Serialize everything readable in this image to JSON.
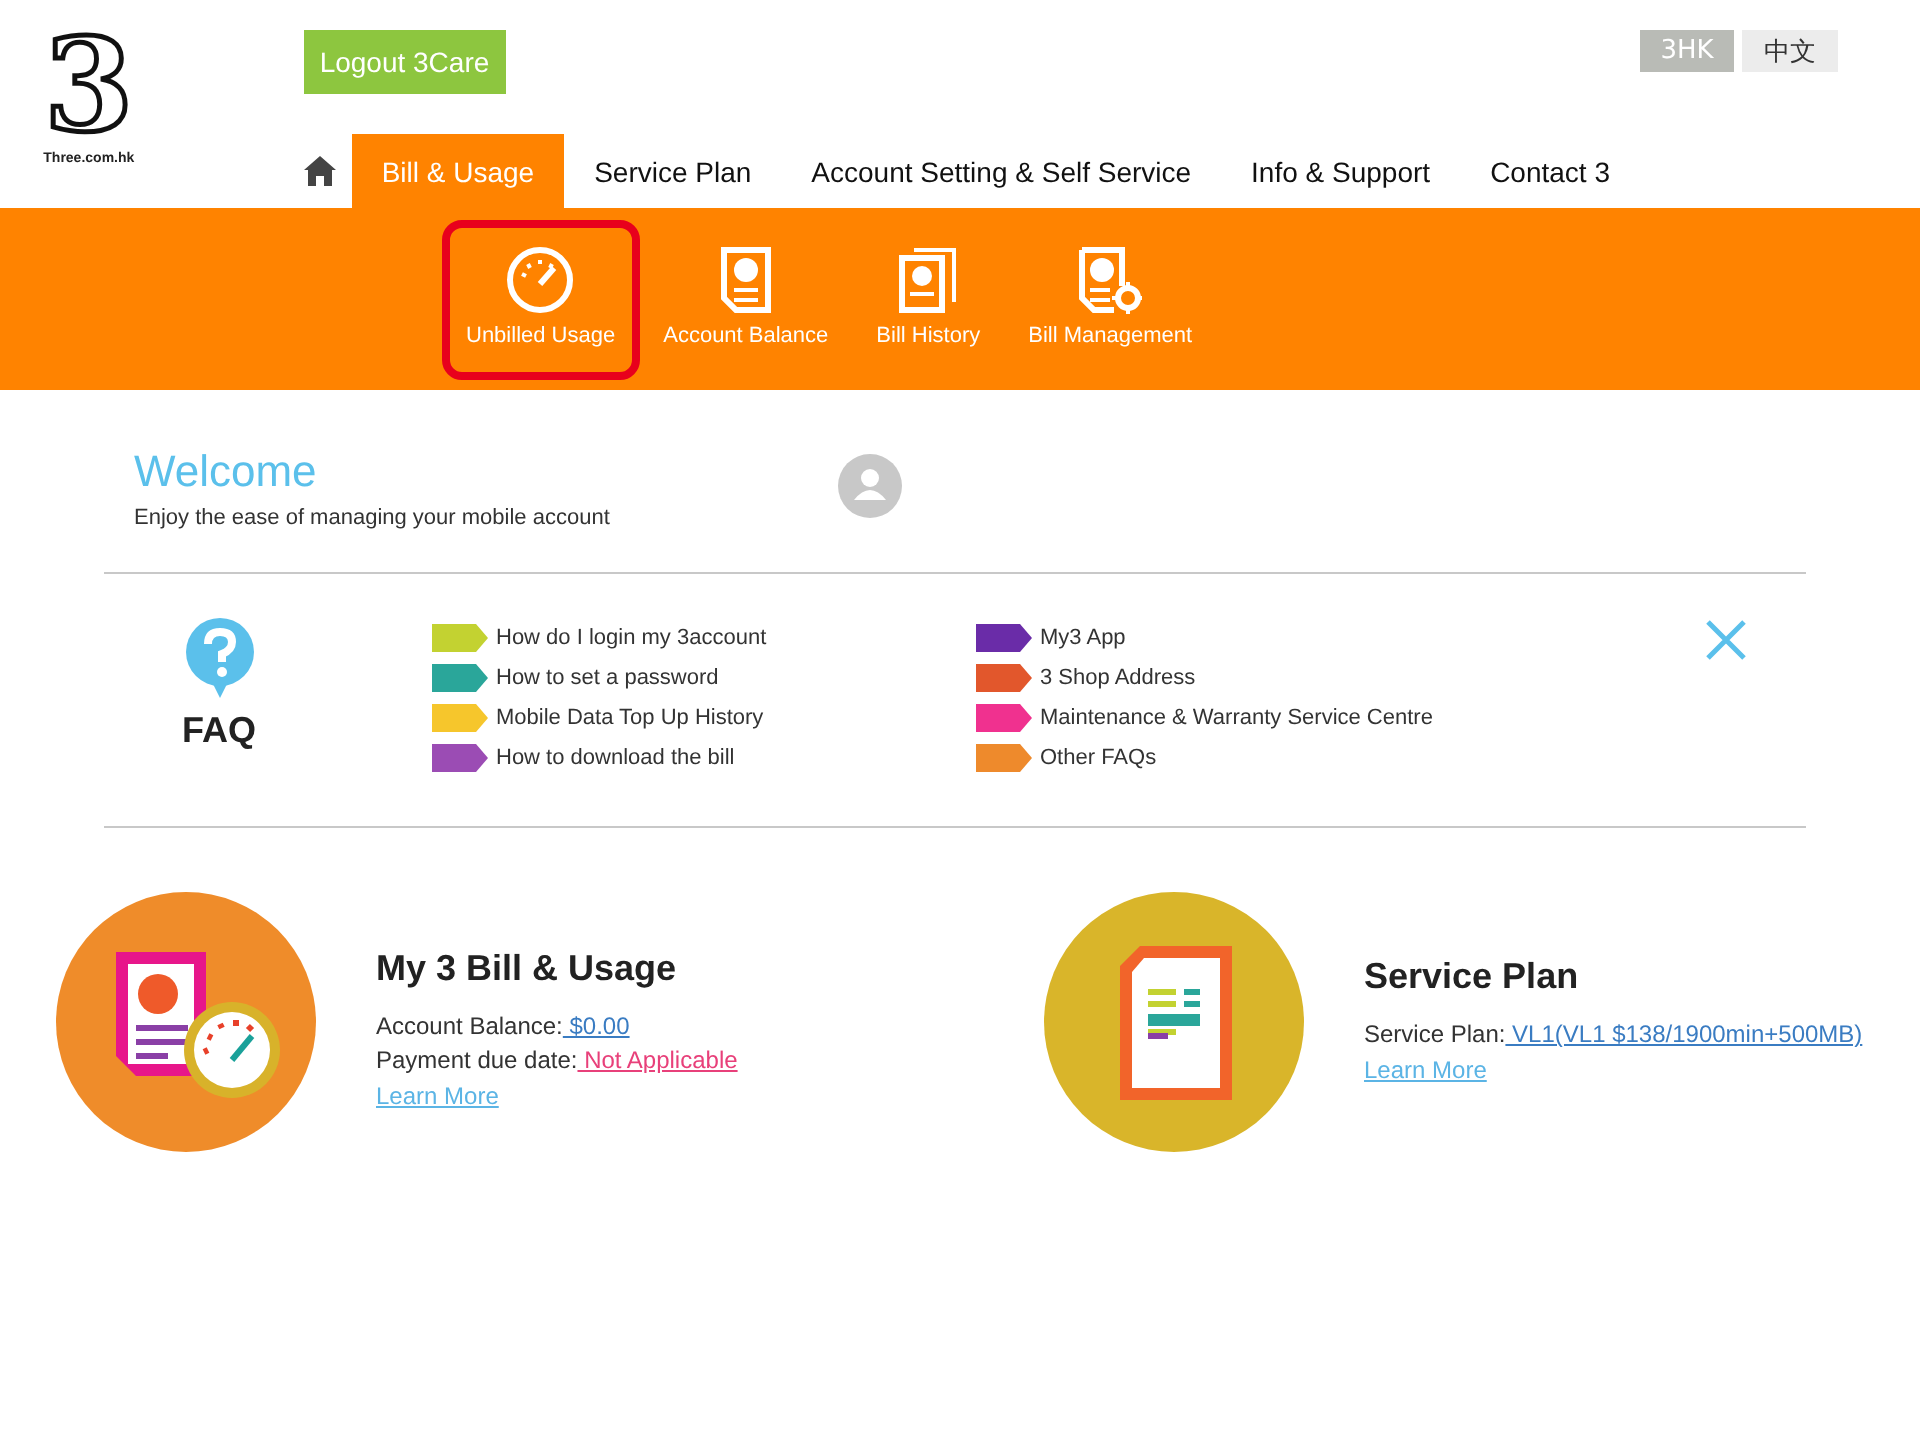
{
  "logo": {
    "mark": "3",
    "caption": "Three.com.hk"
  },
  "logout_button": "Logout 3Care",
  "languages": [
    {
      "label": "3HK",
      "selected": true
    },
    {
      "label": "中文",
      "selected": false
    }
  ],
  "nav": [
    {
      "label": "Bill & Usage",
      "selected": true
    },
    {
      "label": "Service Plan",
      "selected": false
    },
    {
      "label": "Account Setting & Self Service",
      "selected": false
    },
    {
      "label": "Info & Support",
      "selected": false
    },
    {
      "label": "Contact 3",
      "selected": false
    }
  ],
  "subnav": [
    {
      "label": "Unbilled Usage",
      "kind": "gauge",
      "highlighted": true
    },
    {
      "label": "Account Balance",
      "kind": "bill",
      "highlighted": false
    },
    {
      "label": "Bill History",
      "kind": "history",
      "highlighted": false
    },
    {
      "label": "Bill Management",
      "kind": "manage",
      "highlighted": false
    }
  ],
  "welcome": {
    "title": "Welcome",
    "subtitle": "Enjoy the ease of managing your mobile account"
  },
  "faq": {
    "title": "FAQ",
    "links": [
      {
        "label": "How do I login my 3account",
        "color": "#c3d231"
      },
      {
        "label": "How to set a password",
        "color": "#2aa69a"
      },
      {
        "label": "Mobile Data Top Up History",
        "color": "#f6c62c"
      },
      {
        "label": "How to download the bill",
        "color": "#9b4cb4"
      },
      {
        "label": "My3 App",
        "color": "#6a2ca8"
      },
      {
        "label": "3 Shop Address",
        "color": "#e2572c"
      },
      {
        "label": "Maintenance & Warranty Service Centre",
        "color": "#f0318f"
      },
      {
        "label": "Other FAQs",
        "color": "#ee8a2c"
      }
    ]
  },
  "cards": [
    {
      "kind": "bill",
      "title": "My 3 Bill & Usage",
      "lines": [
        {
          "label": "Account Balance:",
          "value": " $0.00",
          "color": "#3a7cc2"
        },
        {
          "label": "Payment due date:",
          "value": " Not Applicable",
          "color": "#e8407a"
        }
      ],
      "link": "Learn More"
    },
    {
      "kind": "plan",
      "title": "Service Plan",
      "lines": [
        {
          "label": "Service Plan:",
          "value": " VL1(VL1 $138/1900min+500MB)",
          "color": "#3a7cc2"
        }
      ],
      "link": "Learn More"
    }
  ]
}
